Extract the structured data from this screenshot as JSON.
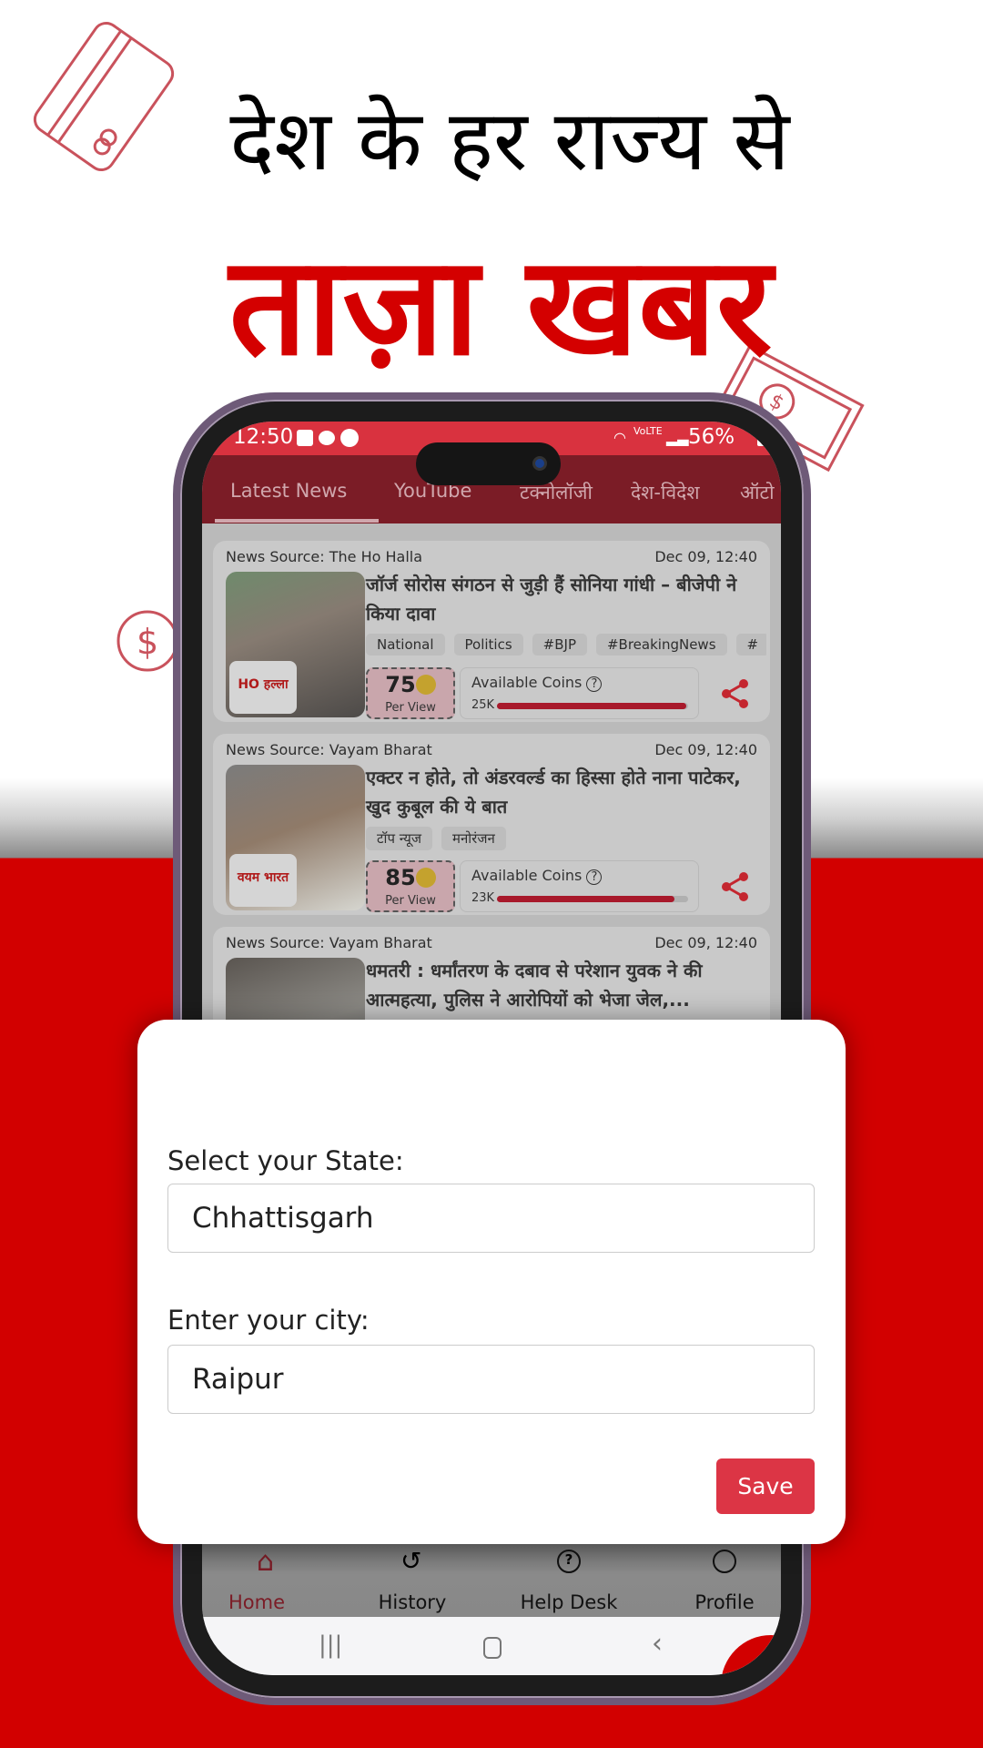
{
  "banner": {
    "line1": "देश के हर राज्य से",
    "line2": "ताज़ा खबर"
  },
  "colors": {
    "brand_red": "#d40000",
    "status_red": "#d9323f",
    "save_button": "#dc3545"
  },
  "status_bar": {
    "time": "12:50",
    "battery": "56%",
    "network": "VoLTE"
  },
  "tabs": [
    {
      "label": "Latest News",
      "active": true
    },
    {
      "label": "YouTube"
    },
    {
      "label": "टक्नोलॉजी"
    },
    {
      "label": "देश-विदेश"
    },
    {
      "label": "ऑटो"
    }
  ],
  "news": [
    {
      "source": "News Source: The Ho Halla",
      "date": "Dec 09, 12:40",
      "title": "जॉर्ज सोरोस संगठन से जुड़ी हैं सोनिया गांधी – बीजेपी ने किया दावा",
      "tags": [
        "National",
        "Politics",
        "#BJP",
        "#BreakingNews",
        "#"
      ],
      "coins": "75",
      "per_view": "Per View",
      "available_label": "Available Coins",
      "available": "25K",
      "progress": 0.99,
      "logo": "HO हल्ला"
    },
    {
      "source": "News Source: Vayam Bharat",
      "date": "Dec 09, 12:40",
      "title": "एक्टर न होते, तो अंडरवर्ल्ड का हिस्सा होते नाना पाटेकर, खुद कुबूल की ये बात",
      "tags": [
        "टॉप न्यूज",
        "मनोरंजन"
      ],
      "coins": "85",
      "per_view": "Per View",
      "available_label": "Available Coins",
      "available": "23K",
      "progress": 0.93,
      "logo": "वयम भारत"
    },
    {
      "source": "News Source: Vayam Bharat",
      "date": "Dec 09, 12:40",
      "title": "धमतरी : धर्मांतरण के दबाव से परेशान युवक ने की आत्महत्या, पुलिस ने आरोपियों को भेजा जेल,..."
    }
  ],
  "bottom_nav": [
    {
      "label": "Home",
      "icon": "home-icon",
      "active": true
    },
    {
      "label": "History",
      "icon": "history-icon"
    },
    {
      "label": "Help Desk",
      "icon": "help-icon"
    },
    {
      "label": "Profile",
      "icon": "profile-icon"
    }
  ],
  "modal": {
    "state_label": "Select your State:",
    "state_value": "Chhattisgarh",
    "city_label": "Enter your city:",
    "city_value": "Raipur",
    "save": "Save"
  }
}
